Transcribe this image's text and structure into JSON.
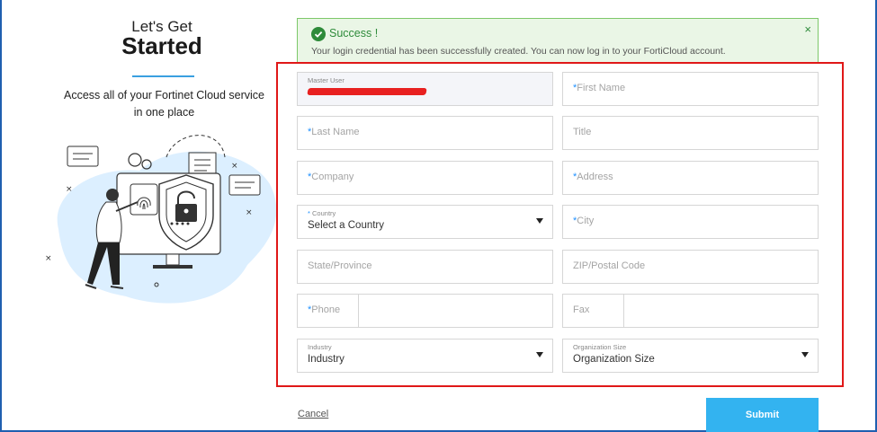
{
  "intro": {
    "heading_small": "Let's Get",
    "heading_big": "Started",
    "tagline": "Access all of your Fortinet Cloud service in one place"
  },
  "banner": {
    "title": "Success !",
    "message": "Your login credential has been successfully created. You can now log in to your FortiCloud account.",
    "close": "×",
    "color": "#2e8b3a"
  },
  "form": {
    "master_user": {
      "label": "Master User"
    },
    "first_name": {
      "placeholder": "First Name",
      "required": "*"
    },
    "last_name": {
      "placeholder": "Last Name",
      "required": "*"
    },
    "title": {
      "placeholder": "Title"
    },
    "company": {
      "placeholder": "Company",
      "required": "*"
    },
    "address": {
      "placeholder": "Address",
      "required": "*"
    },
    "country": {
      "label": "Country",
      "value": "Select a Country",
      "required": "*"
    },
    "city": {
      "placeholder": "City",
      "required": "*"
    },
    "state": {
      "placeholder": "State/Province"
    },
    "zip": {
      "placeholder": "ZIP/Postal Code"
    },
    "phone": {
      "placeholder": "Phone",
      "required": "*"
    },
    "fax": {
      "placeholder": "Fax"
    },
    "industry": {
      "label": "Industry",
      "value": "Industry"
    },
    "org_size": {
      "label": "Organization Size",
      "value": "Organization Size"
    }
  },
  "actions": {
    "cancel": "Cancel",
    "submit": "Submit",
    "submit_color": "#33b3f0"
  },
  "highlight_color": "#e01818"
}
